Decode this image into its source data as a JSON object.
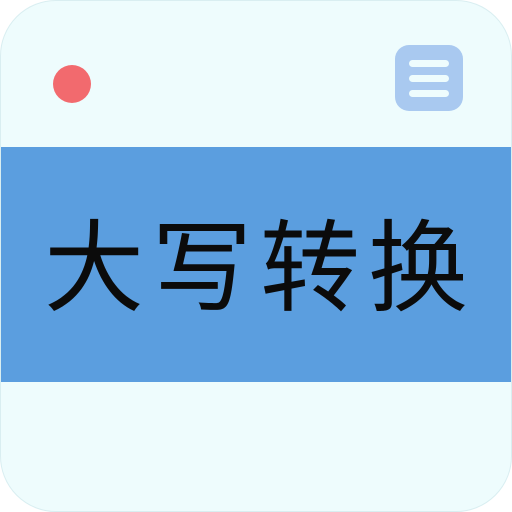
{
  "app": {
    "title": "大写转换"
  },
  "icons": {
    "status_dot": "record-dot-icon",
    "menu": "menu-icon"
  },
  "colors": {
    "background": "#eefcfd",
    "banner": "#5b9edf",
    "dot": "#f26a6e",
    "menu_button": "#a9c9f0",
    "title_text": "#0b0b0b"
  }
}
